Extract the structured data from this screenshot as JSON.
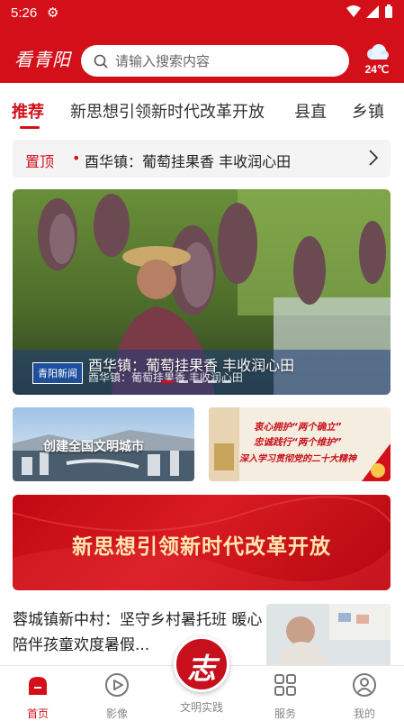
{
  "status_bar": {
    "time": "5:26"
  },
  "header": {
    "logo_text": "看青阳",
    "search_placeholder": "请输入搜索内容",
    "weather_temp": "24℃",
    "weather_icon": "cloud-icon"
  },
  "tabs": [
    {
      "label": "推荐",
      "active": true
    },
    {
      "label": "新思想引领新时代改革开放",
      "active": false
    },
    {
      "label": "县直",
      "active": false
    },
    {
      "label": "乡镇",
      "active": false
    }
  ],
  "pinned": {
    "tag": "置顶",
    "dot": "•",
    "title": "酉华镇：葡萄挂果香 丰收润心田"
  },
  "banner": {
    "title": "酉华镇：葡萄挂果香 丰收润心田",
    "subtitle": "酉华镇：葡萄挂果香 丰收润心田",
    "source": "青阳新闻",
    "active_index": 0,
    "slide_count": 5
  },
  "cards": {
    "left_text": "创建全国文明城市",
    "right_lines": [
      "衷心拥护“两个确立”",
      "忠诚践行“两个维护”",
      "深入学习贯彻党的二十大精神"
    ]
  },
  "promo_banner": {
    "text": "新思想引领新时代改革开放"
  },
  "news": [
    {
      "title": "蓉城镇新中村：坚守乡村暑托班 暖心陪伴孩童欢度暑假..."
    }
  ],
  "bottom_nav": [
    {
      "label": "首页",
      "icon": "home-icon",
      "active": true
    },
    {
      "label": "影像",
      "icon": "play-icon",
      "active": false
    },
    {
      "label": "文明实践",
      "icon": "volunteer-icon",
      "active": false
    },
    {
      "label": "服务",
      "icon": "grid-icon",
      "active": false
    },
    {
      "label": "我的",
      "icon": "user-icon",
      "active": false
    }
  ],
  "center_button_glyph": "志",
  "colors": {
    "brand_red": "#d3101a"
  }
}
